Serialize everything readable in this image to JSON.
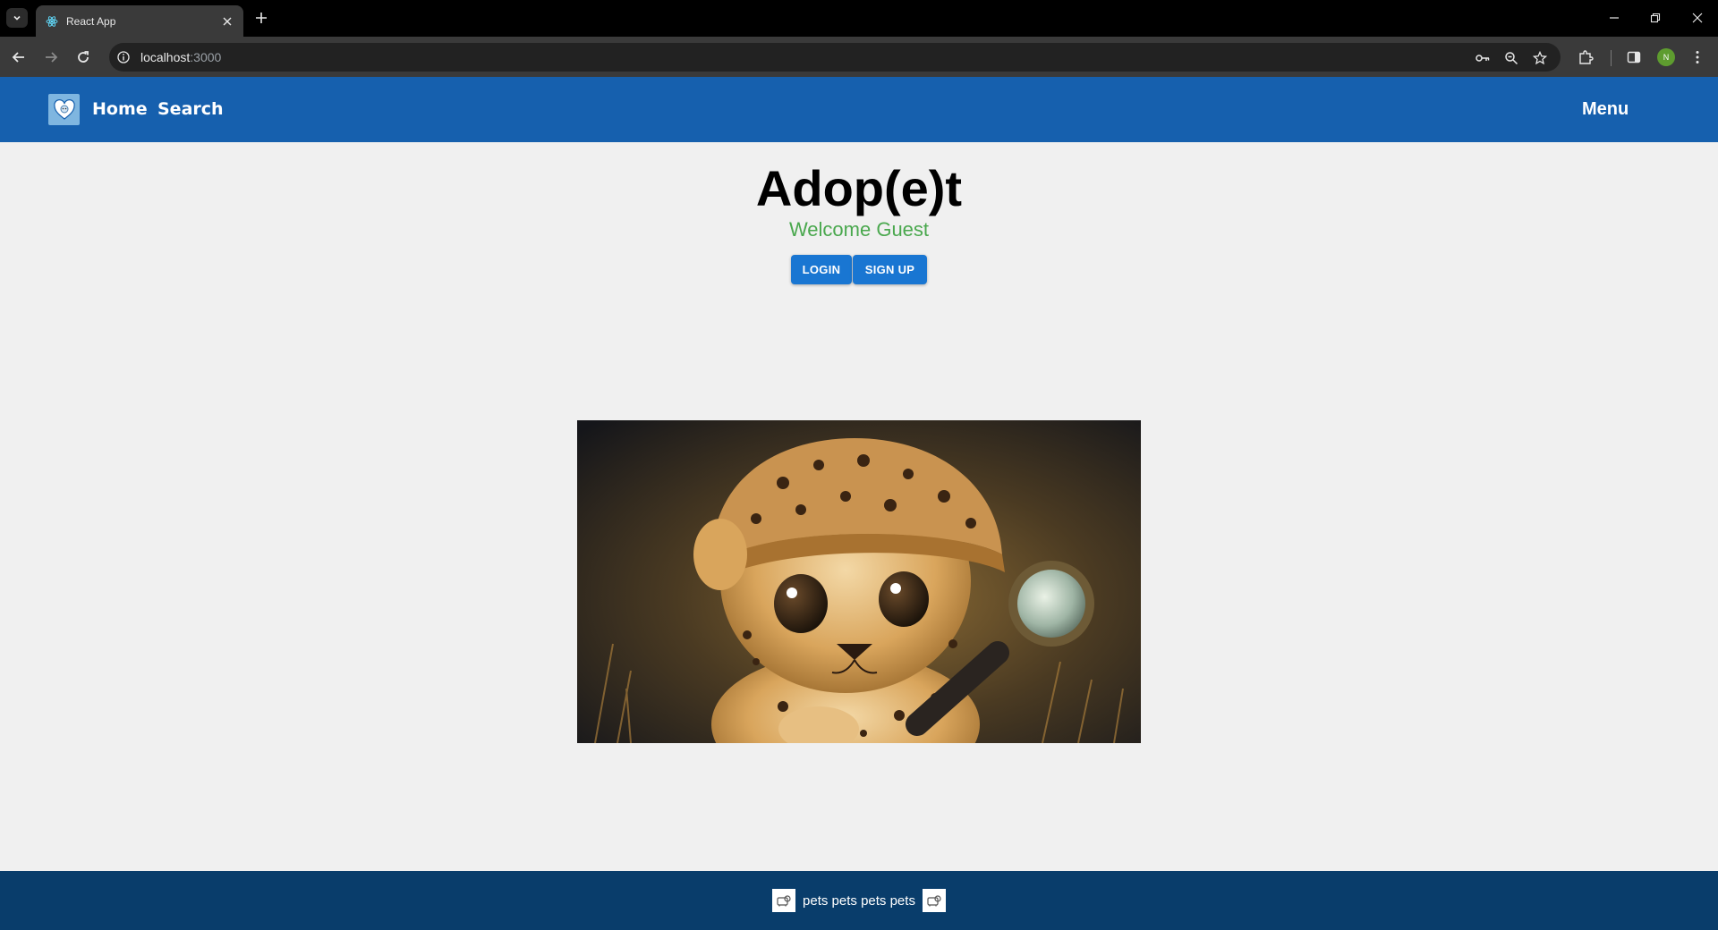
{
  "browser": {
    "tab_title": "React App",
    "url_host": "localhost",
    "url_port": ":3000",
    "avatar_letter": "N"
  },
  "header": {
    "nav_home": "Home",
    "nav_search": "Search",
    "menu_label": "Menu"
  },
  "main": {
    "title": "Adop(e)t",
    "welcome": "Welcome Guest",
    "login_label": "LOGIN",
    "signup_label": "SIGN UP"
  },
  "footer": {
    "text": "pets pets pets pets"
  },
  "colors": {
    "header_bg": "#1660ae",
    "footer_bg": "#093d6b",
    "button_bg": "#1976d2",
    "welcome_text": "#4aa84e"
  },
  "icons": [
    "tab-list-icon",
    "react-favicon-icon",
    "close-icon",
    "plus-icon",
    "minimize-icon",
    "restore-icon",
    "window-close-icon",
    "back-arrow-icon",
    "forward-arrow-icon",
    "reload-icon",
    "info-icon",
    "password-key-icon",
    "zoom-icon",
    "star-icon",
    "extensions-icon",
    "side-panel-icon",
    "kebab-menu-icon",
    "logo-icon",
    "pet-icon"
  ]
}
